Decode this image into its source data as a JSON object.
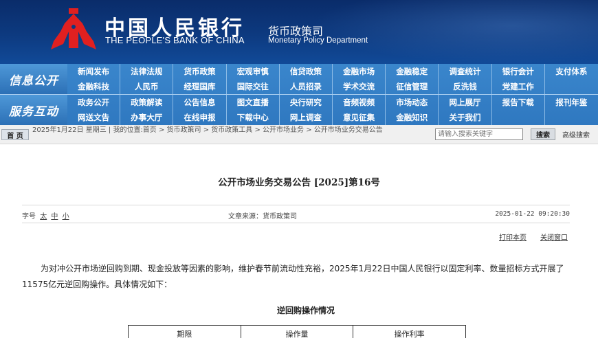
{
  "header": {
    "bank_name_cn": "中国人民银行",
    "bank_name_en": "THE PEOPLE'S BANK OF CHINA",
    "dept_cn": "货币政策司",
    "dept_en": "Monetary Policy Department",
    "logo_icon": "pboc-logo-icon",
    "colors": {
      "banner": "#0d3a80",
      "logo": "#e02020",
      "nav": "#3a86cc"
    }
  },
  "nav": {
    "section1": {
      "label": "信息公开",
      "row1": [
        "新闻发布",
        "法律法规",
        "货币政策",
        "宏观审慎",
        "信贷政策",
        "金融市场",
        "金融稳定",
        "调查统计",
        "银行会计",
        "支付体系"
      ],
      "row2": [
        "金融科技",
        "人民币",
        "经理国库",
        "国际交往",
        "人员招录",
        "学术交流",
        "征信管理",
        "反洗钱",
        "党建工作",
        ""
      ]
    },
    "section2": {
      "label": "服务互动",
      "row1": [
        "政务公开",
        "政策解读",
        "公告信息",
        "图文直播",
        "央行研究",
        "音频视频",
        "市场动态",
        "网上展厅",
        "报告下载",
        "报刊年鉴"
      ],
      "row2": [
        "网送文告",
        "办事大厅",
        "在线申报",
        "下载中心",
        "网上调查",
        "意见征集",
        "金融知识",
        "关于我们",
        "",
        ""
      ]
    }
  },
  "breadcrumb": {
    "home_label": "首 页",
    "text": "2025年1月22日 星期三 | 我的位置:首页 > 货币政策司 > 货币政策工具 > 公开市场业务 > 公开市场业务交易公告",
    "search_placeholder": "请输入搜索关键字",
    "search_label": "搜索",
    "advanced_label": "高级搜索"
  },
  "article": {
    "title": "公开市场业务交易公告 [2025]第16号",
    "font_size_label": "字号",
    "font_sizes": [
      "太",
      "中",
      "小"
    ],
    "source": "文章来源：货币政策司",
    "date": "2025-01-22 09:20:30",
    "print_label": "打印本页",
    "close_label": "关闭窗口",
    "body": "为对冲公开市场逆回购到期、现金投放等因素的影响，维护春节前流动性充裕，2025年1月22日中国人民银行以固定利率、数量招标方式开展了11575亿元逆回购操作。具体情况如下：",
    "table_title": "逆回购操作情况",
    "table_headers": [
      "期限",
      "操作量",
      "操作利率"
    ]
  }
}
